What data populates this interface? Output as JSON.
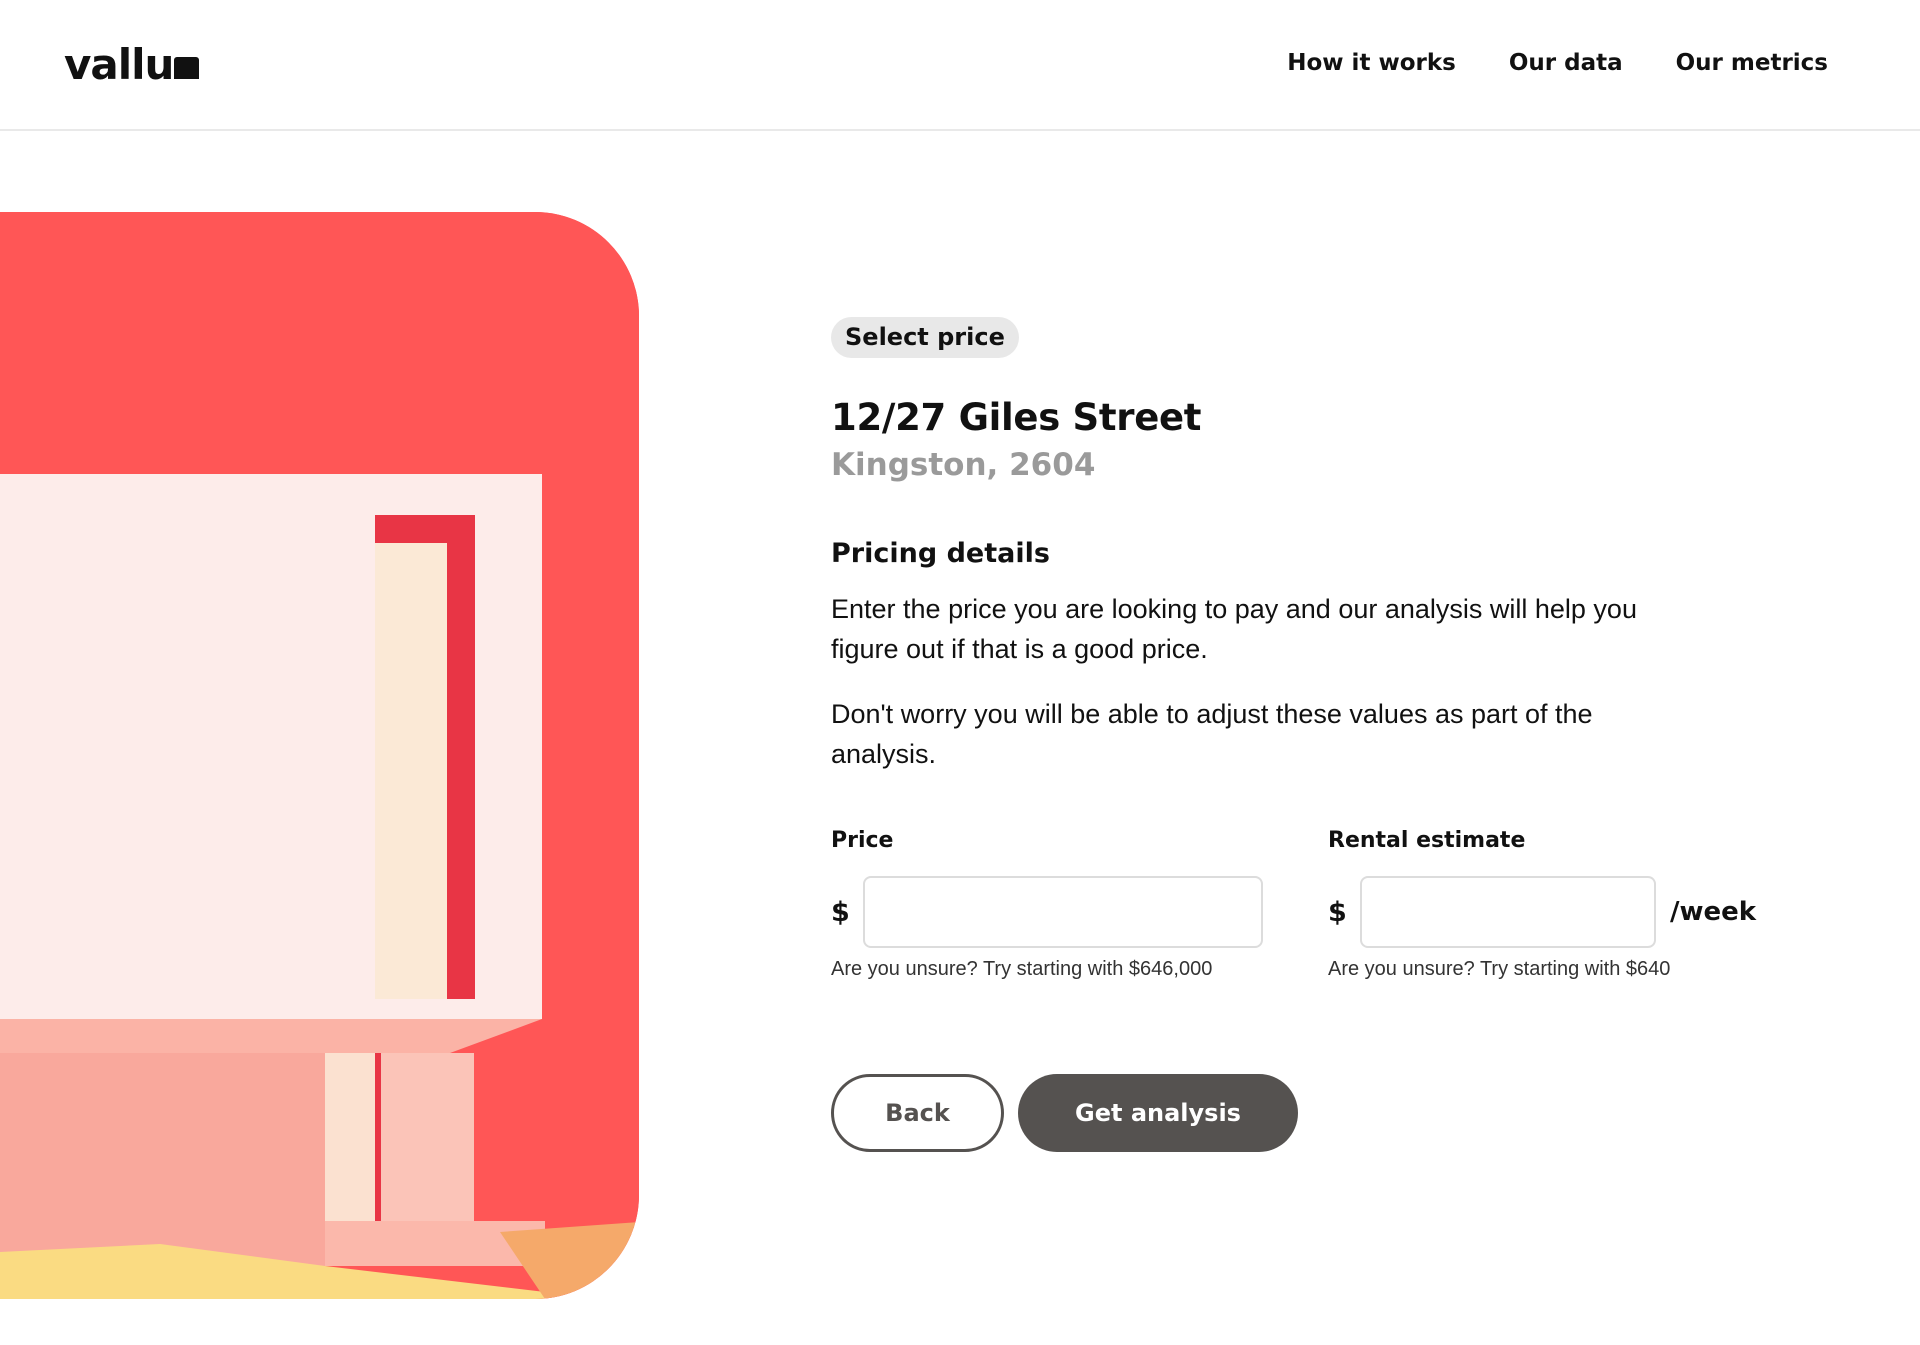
{
  "brand": {
    "logo_text": "vallu"
  },
  "nav": {
    "items": [
      {
        "label": "How it works"
      },
      {
        "label": "Our data"
      },
      {
        "label": "Our metrics"
      }
    ]
  },
  "step": {
    "label": "Select price"
  },
  "property": {
    "address": "12/27 Giles Street",
    "suburb": "Kingston, 2604"
  },
  "pricing": {
    "title": "Pricing details",
    "paragraphs": [
      "Enter the price you are looking to pay and our analysis will help you figure out if that is a good price.",
      "Don't worry you will be able to adjust these values as part of the analysis."
    ]
  },
  "form": {
    "price": {
      "label": "Price",
      "currency": "$",
      "value": "",
      "hint": "Are you unsure? Try starting with $646,000"
    },
    "rent": {
      "label": "Rental estimate",
      "currency": "$",
      "value": "",
      "suffix": "/week",
      "hint": "Are you unsure? Try starting with $640"
    }
  },
  "actions": {
    "back_label": "Back",
    "submit_label": "Get analysis"
  },
  "colors": {
    "hero_red": "#ff5656",
    "button_dark": "#555250",
    "pill_bg": "#e8e8e8",
    "muted_text": "#9a9a9a"
  }
}
